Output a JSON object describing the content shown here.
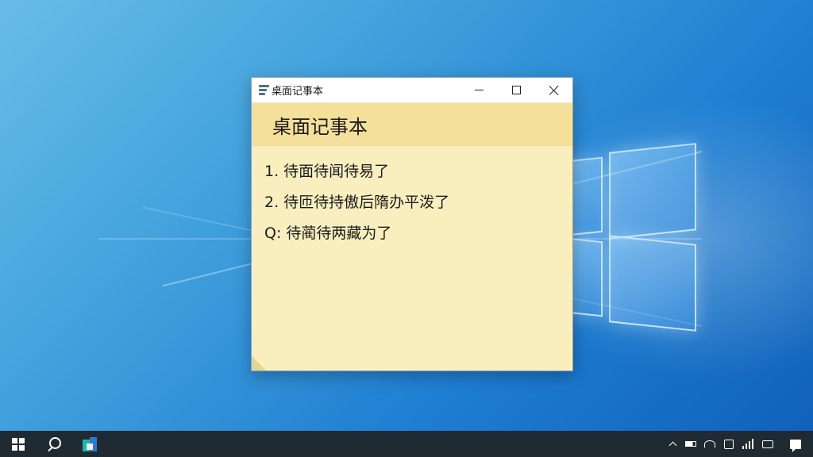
{
  "desktop": {
    "wallpaper_colors": [
      "#67bde6",
      "#1f7fd2",
      "#0f5fb8"
    ]
  },
  "window": {
    "title": "桌面记事本",
    "icon": "notepad-icon",
    "controls": {
      "minimize_icon": "minimize-icon",
      "maximize_icon": "maximize-icon",
      "close_icon": "close-icon"
    },
    "background_color": "#f9efbe",
    "header_color": "#f4e09b"
  },
  "note": {
    "heading": "桌面记事本",
    "items": [
      "1. 待面待闻待易了",
      "2. 待匝待持傲后隋办平泼了",
      "Q: 待蔺待两藏为了"
    ]
  },
  "taskbar": {
    "background_color": "#1f2a33",
    "start_icon": "windows-start-icon",
    "search_icon": "search-icon",
    "pinned_apps": [
      "sticky-notes-app-icon"
    ],
    "tray_icons": [
      "chevron-up-icon",
      "battery-icon",
      "network-icon",
      "settings-icon",
      "signal-icon",
      "speaker-icon",
      "action-center-icon"
    ]
  }
}
